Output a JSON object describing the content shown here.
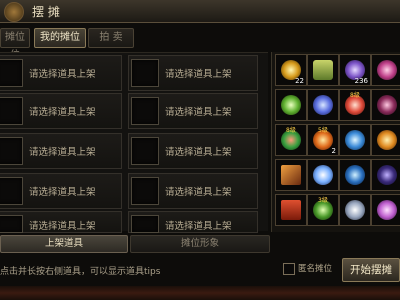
{
  "window": {
    "title": "摆 摊"
  },
  "tabs": [
    {
      "label": "摊位位"
    },
    {
      "label": "我的摊位"
    },
    {
      "label": "拍 卖"
    }
  ],
  "slot_placeholder": "请选择道具上架",
  "slots_count_note": "10 visible listing slots",
  "inventory": {
    "items": [
      {
        "icon": "golden-sparkle-gem-icon",
        "count": "22"
      },
      {
        "icon": "green-scroll-icon",
        "count": ""
      },
      {
        "icon": "purple-shard-icon",
        "count": "236"
      },
      {
        "icon": "pink-gem-icon",
        "count": ""
      },
      {
        "icon": "green-orb-icon",
        "count": ""
      },
      {
        "icon": "blue-crystal-icon",
        "count": ""
      },
      {
        "icon": "red-star-gem-icon",
        "count": "",
        "level": "8级"
      },
      {
        "icon": "dark-blossom-icon",
        "count": ""
      },
      {
        "icon": "red-gem-green-frame-icon",
        "count": "",
        "level": "8级"
      },
      {
        "icon": "fire-flower-icon",
        "count": "2",
        "level": "5级"
      },
      {
        "icon": "blue-swirl-icon",
        "count": ""
      },
      {
        "icon": "orange-burst-icon",
        "count": ""
      },
      {
        "icon": "orange-key-icon",
        "count": ""
      },
      {
        "icon": "blue-ring-icon",
        "count": ""
      },
      {
        "icon": "blue-orb-icon",
        "count": ""
      },
      {
        "icon": "dark-crystal-icon",
        "count": ""
      },
      {
        "icon": "red-scroll-icon",
        "count": ""
      },
      {
        "icon": "green-stone-icon",
        "count": "",
        "level": "3级"
      },
      {
        "icon": "silver-orb-icon",
        "count": ""
      },
      {
        "icon": "pink-spiral-icon",
        "count": ""
      }
    ]
  },
  "buttons": {
    "list_item": "上架道具",
    "stall_look": "摊位形象",
    "start": "开始摆摊"
  },
  "hint": "点击并长按右侧道具，可以显示道具tips",
  "anonymous_label": "匿名摊位"
}
